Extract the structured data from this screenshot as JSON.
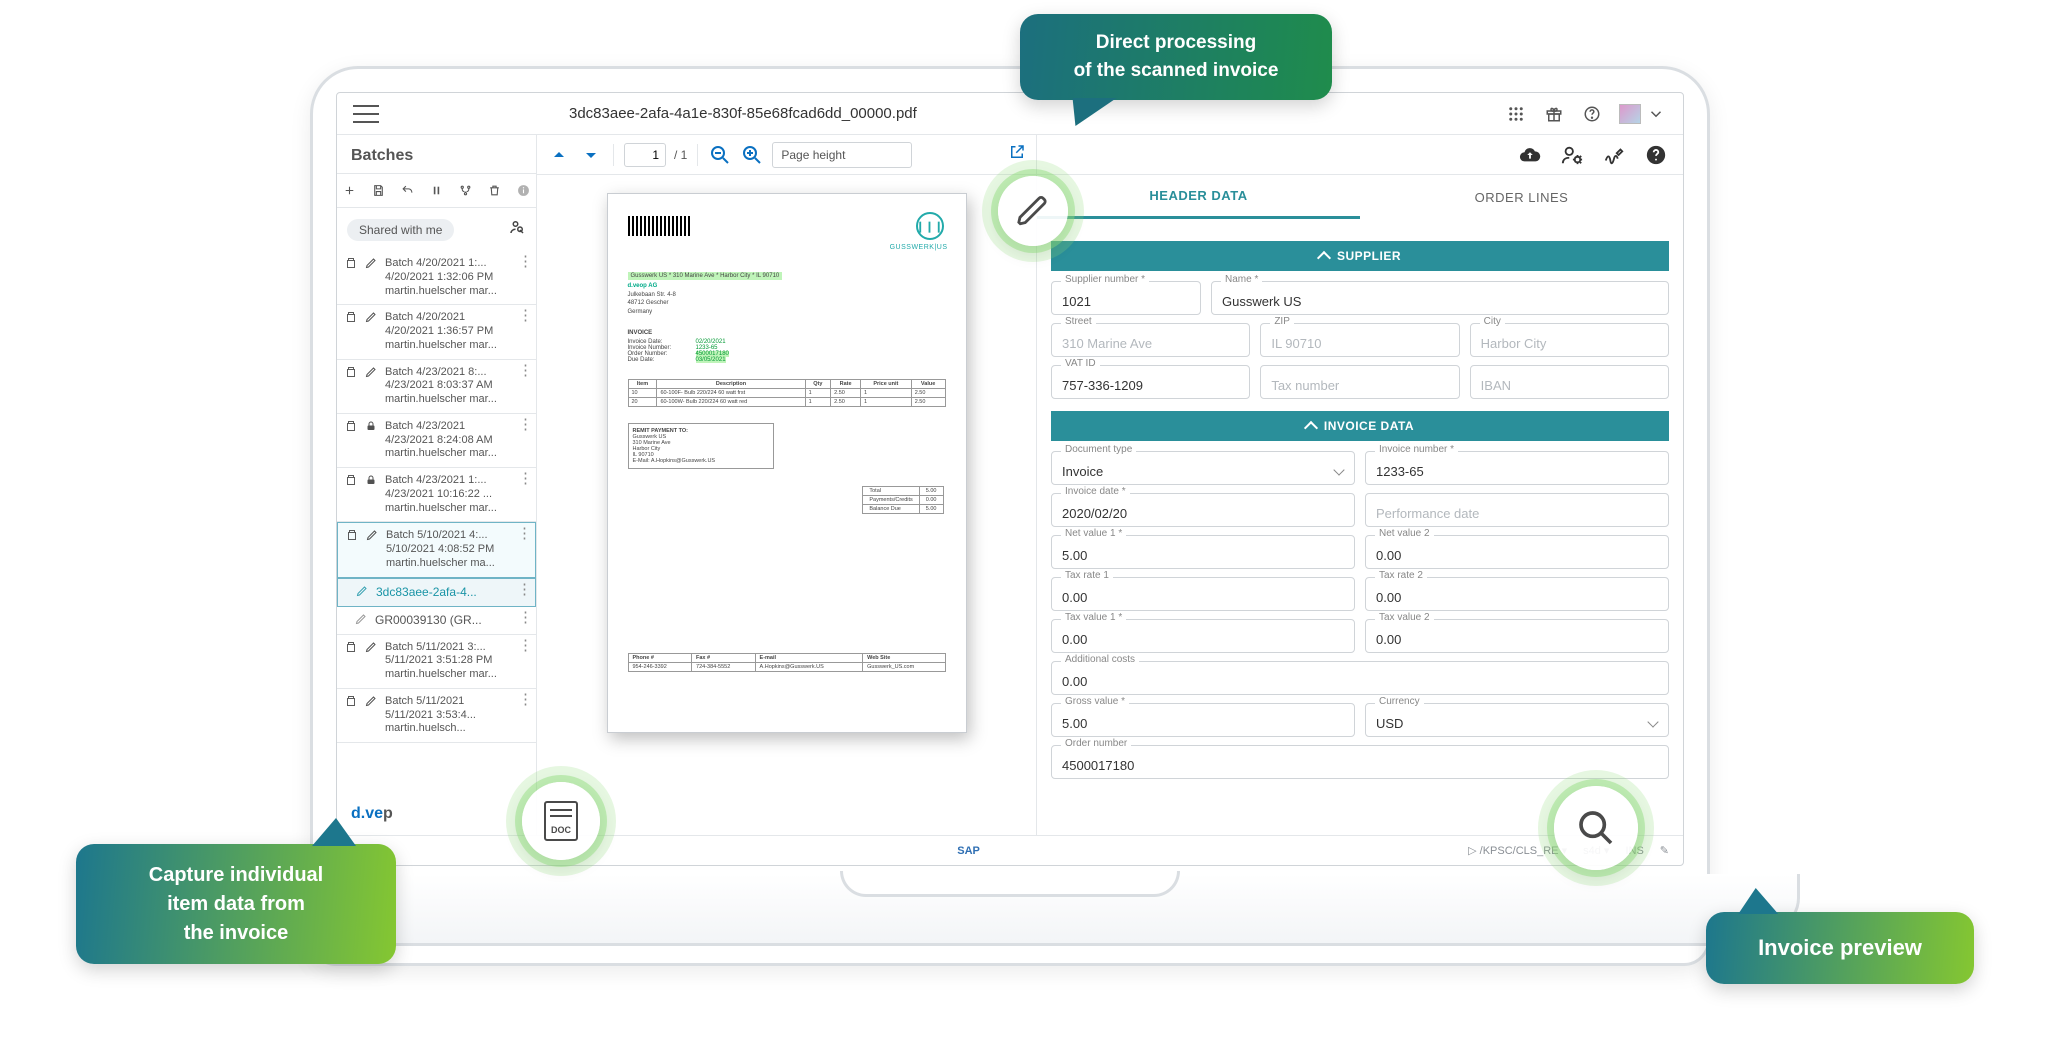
{
  "topbar": {
    "title": "3dc83aee-2afa-4a1e-830f-85e68fcad6dd_00000.pdf"
  },
  "batches": {
    "heading": "Batches",
    "shared_chip": "Shared with me",
    "selected_child1": "3dc83aee-2afa-4...",
    "selected_child2": "GR00039130 (GR...",
    "items": [
      {
        "l1": "Batch 4/20/2021 1:...",
        "l2": "4/20/2021 1:32:06 PM",
        "l3": "martin.huelscher mar...",
        "lock": false
      },
      {
        "l1": "Batch 4/20/2021",
        "l2": "4/20/2021 1:36:57 PM",
        "l3": "martin.huelscher mar...",
        "lock": false
      },
      {
        "l1": "Batch 4/23/2021 8:...",
        "l2": "4/23/2021 8:03:37 AM",
        "l3": "martin.huelscher mar...",
        "lock": false
      },
      {
        "l1": "Batch 4/23/2021",
        "l2": "4/23/2021 8:24:08 AM",
        "l3": "martin.huelscher mar...",
        "lock": true
      },
      {
        "l1": "Batch 4/23/2021 1:...",
        "l2": "4/23/2021 10:16:22 ...",
        "l3": "martin.huelscher mar...",
        "lock": true
      },
      {
        "l1": "Batch 5/10/2021 4:...",
        "l2": "5/10/2021 4:08:52 PM",
        "l3": "martin.huelscher ma...",
        "lock": false,
        "selected": true
      },
      {
        "l1": "Batch 5/11/2021 3:...",
        "l2": "5/11/2021 3:51:28 PM",
        "l3": "martin.huelscher mar...",
        "lock": false
      },
      {
        "l1": "Batch 5/11/2021",
        "l2": "5/11/2021 3:53:4...",
        "l3": "martin.huelsch...",
        "lock": false
      }
    ],
    "brand_pre": "d.",
    "brand_mid": "ve",
    "brand_post": "p"
  },
  "viewer": {
    "page_current": "1",
    "page_total": "/ 1",
    "zoom_mode": "Page height"
  },
  "invoice_page": {
    "company": "Gusswerk US",
    "addr_hl": "Gusswerk US * 310 Marine Ave * Harbor City * IL 90710",
    "to": [
      "d.veop AG",
      "Julkebaan Str. 4-8",
      "48712 Gescher",
      "Germany"
    ],
    "label_inv": "INVOICE",
    "kv": [
      {
        "k": "Invoice Date:",
        "v": "02/20/2021"
      },
      {
        "k": "Invoice Number:",
        "v": "1233-65"
      },
      {
        "k": "Order Number:",
        "v": "4500017180"
      },
      {
        "k": "Due Date:",
        "v": "03/05/2021"
      }
    ],
    "line_hdr": [
      "Item",
      "Description",
      "Qty",
      "Rate",
      "Price unit",
      "Value"
    ],
    "lines": [
      [
        "10",
        "60-100F- Bulb 220/224 60 watt frst",
        "1",
        "2.50",
        "1",
        "2.50"
      ],
      [
        "20",
        "60-100W- Bulb 220/224 60 watt red",
        "1",
        "2.50",
        "1",
        "2.50"
      ]
    ],
    "remit_hd": "REMIT PAYMENT TO:",
    "remit": [
      "Gusswerk US",
      "310 Marine Ave",
      "Harbor City",
      "IL 90710",
      "E-Mail: A.Hopkins@Gusswerk.US"
    ],
    "totals": [
      [
        "Total",
        "5.00"
      ],
      [
        "Payments/Credits",
        "0.00"
      ],
      [
        "Balance Due",
        "5.00"
      ]
    ],
    "foot_hdr": [
      "Phone #",
      "Fax #",
      "E-mail",
      "Web Site"
    ],
    "foot_row": [
      "954-246-3392",
      "724-384-5552",
      "A.Hopkins@Gusswerk.US",
      "Gusswerk_US.com"
    ],
    "logo_caption": "GUSSWERK|US"
  },
  "tabs": {
    "header": "HEADER DATA",
    "order": "ORDER LINES"
  },
  "sections": {
    "supplier": "SUPPLIER",
    "invoice": "INVOICE DATA"
  },
  "form": {
    "supplier": {
      "number_lbl": "Supplier number *",
      "number": "1021",
      "name_lbl": "Name *",
      "name": "Gusswerk US",
      "street_lbl": "Street",
      "street_ph": "310 Marine Ave",
      "zip_lbl": "ZIP",
      "zip_ph": "IL 90710",
      "city_lbl": "City",
      "city_ph": "Harbor City",
      "vat_lbl": "VAT ID",
      "vat": "757-336-1209",
      "taxno_ph": "Tax number",
      "iban_ph": "IBAN"
    },
    "invoice": {
      "doctype_lbl": "Document type",
      "doctype": "Invoice",
      "invno_lbl": "Invoice number *",
      "invno": "1233-65",
      "invdate_lbl": "Invoice date *",
      "invdate": "2020/02/20",
      "perfd_ph": "Performance date",
      "net1_lbl": "Net value 1 *",
      "net1": "5.00",
      "net2_lbl": "Net value 2",
      "net2": "0.00",
      "taxr1_lbl": "Tax rate 1",
      "taxr1": "0.00",
      "taxr2_lbl": "Tax rate 2",
      "taxr2": "0.00",
      "taxv1_lbl": "Tax value 1 *",
      "taxv1": "0.00",
      "taxv2_lbl": "Tax value 2",
      "taxv2": "0.00",
      "addc_lbl": "Additional costs",
      "addc": "0.00",
      "gross_lbl": "Gross value *",
      "gross": "5.00",
      "curr_lbl": "Currency",
      "curr": "USD",
      "ord_lbl": "Order number",
      "ord": "4500017180"
    }
  },
  "status": {
    "sap": "SAP",
    "path_prefix": "▷ /KPSC/CLS_RE ▾",
    "mode": "s4d ▾",
    "ins": "INS"
  },
  "callouts": {
    "c1": "Direct processing\nof the scanned  invoice",
    "c2": "Capture individual\nitem data from\nthe invoice",
    "c3": "Invoice preview"
  }
}
